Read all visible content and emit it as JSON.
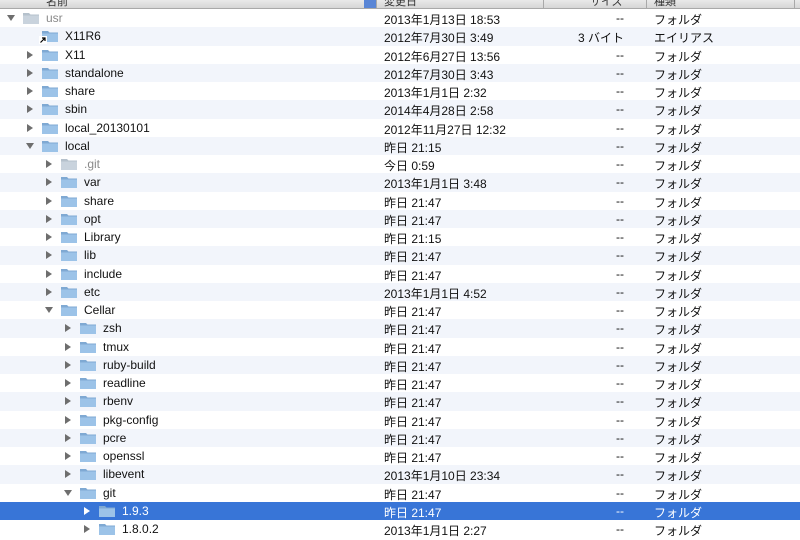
{
  "columns": {
    "name": "名前",
    "date": "変更日",
    "size": "サイズ",
    "kind": "種類"
  },
  "colors": {
    "selection": "#3875d7",
    "folder_body": "#9cc3e8",
    "folder_tab": "#7fa9d3",
    "alternate_row": "#f2f5fb"
  },
  "rows": [
    {
      "name": "usr",
      "date": "2013年1月13日 18:53",
      "size": "--",
      "kind": "フォルダ",
      "depth": 0,
      "expanded": true,
      "has_children": true,
      "dim": true
    },
    {
      "name": "X11R6",
      "date": "2012年7月30日 3:49",
      "size": "3 バイト",
      "kind": "エイリアス",
      "depth": 1,
      "expanded": false,
      "has_children": false,
      "alias": true
    },
    {
      "name": "X11",
      "date": "2012年6月27日 13:56",
      "size": "--",
      "kind": "フォルダ",
      "depth": 1,
      "expanded": false,
      "has_children": true
    },
    {
      "name": "standalone",
      "date": "2012年7月30日 3:43",
      "size": "--",
      "kind": "フォルダ",
      "depth": 1,
      "expanded": false,
      "has_children": true
    },
    {
      "name": "share",
      "date": "2013年1月1日 2:32",
      "size": "--",
      "kind": "フォルダ",
      "depth": 1,
      "expanded": false,
      "has_children": true
    },
    {
      "name": "sbin",
      "date": "2014年4月28日 2:58",
      "size": "--",
      "kind": "フォルダ",
      "depth": 1,
      "expanded": false,
      "has_children": true
    },
    {
      "name": "local_20130101",
      "date": "2012年11月27日 12:32",
      "size": "--",
      "kind": "フォルダ",
      "depth": 1,
      "expanded": false,
      "has_children": true
    },
    {
      "name": "local",
      "date": "昨日 21:15",
      "size": "--",
      "kind": "フォルダ",
      "depth": 1,
      "expanded": true,
      "has_children": true
    },
    {
      "name": ".git",
      "date": "今日 0:59",
      "size": "--",
      "kind": "フォルダ",
      "depth": 2,
      "expanded": false,
      "has_children": true,
      "dim": true
    },
    {
      "name": "var",
      "date": "2013年1月1日 3:48",
      "size": "--",
      "kind": "フォルダ",
      "depth": 2,
      "expanded": false,
      "has_children": true
    },
    {
      "name": "share",
      "date": "昨日 21:47",
      "size": "--",
      "kind": "フォルダ",
      "depth": 2,
      "expanded": false,
      "has_children": true
    },
    {
      "name": "opt",
      "date": "昨日 21:47",
      "size": "--",
      "kind": "フォルダ",
      "depth": 2,
      "expanded": false,
      "has_children": true
    },
    {
      "name": "Library",
      "date": "昨日 21:15",
      "size": "--",
      "kind": "フォルダ",
      "depth": 2,
      "expanded": false,
      "has_children": true
    },
    {
      "name": "lib",
      "date": "昨日 21:47",
      "size": "--",
      "kind": "フォルダ",
      "depth": 2,
      "expanded": false,
      "has_children": true
    },
    {
      "name": "include",
      "date": "昨日 21:47",
      "size": "--",
      "kind": "フォルダ",
      "depth": 2,
      "expanded": false,
      "has_children": true
    },
    {
      "name": "etc",
      "date": "2013年1月1日 4:52",
      "size": "--",
      "kind": "フォルダ",
      "depth": 2,
      "expanded": false,
      "has_children": true
    },
    {
      "name": "Cellar",
      "date": "昨日 21:47",
      "size": "--",
      "kind": "フォルダ",
      "depth": 2,
      "expanded": true,
      "has_children": true
    },
    {
      "name": "zsh",
      "date": "昨日 21:47",
      "size": "--",
      "kind": "フォルダ",
      "depth": 3,
      "expanded": false,
      "has_children": true
    },
    {
      "name": "tmux",
      "date": "昨日 21:47",
      "size": "--",
      "kind": "フォルダ",
      "depth": 3,
      "expanded": false,
      "has_children": true
    },
    {
      "name": "ruby-build",
      "date": "昨日 21:47",
      "size": "--",
      "kind": "フォルダ",
      "depth": 3,
      "expanded": false,
      "has_children": true
    },
    {
      "name": "readline",
      "date": "昨日 21:47",
      "size": "--",
      "kind": "フォルダ",
      "depth": 3,
      "expanded": false,
      "has_children": true
    },
    {
      "name": "rbenv",
      "date": "昨日 21:47",
      "size": "--",
      "kind": "フォルダ",
      "depth": 3,
      "expanded": false,
      "has_children": true
    },
    {
      "name": "pkg-config",
      "date": "昨日 21:47",
      "size": "--",
      "kind": "フォルダ",
      "depth": 3,
      "expanded": false,
      "has_children": true
    },
    {
      "name": "pcre",
      "date": "昨日 21:47",
      "size": "--",
      "kind": "フォルダ",
      "depth": 3,
      "expanded": false,
      "has_children": true
    },
    {
      "name": "openssl",
      "date": "昨日 21:47",
      "size": "--",
      "kind": "フォルダ",
      "depth": 3,
      "expanded": false,
      "has_children": true
    },
    {
      "name": "libevent",
      "date": "2013年1月10日 23:34",
      "size": "--",
      "kind": "フォルダ",
      "depth": 3,
      "expanded": false,
      "has_children": true
    },
    {
      "name": "git",
      "date": "昨日 21:47",
      "size": "--",
      "kind": "フォルダ",
      "depth": 3,
      "expanded": true,
      "has_children": true
    },
    {
      "name": "1.9.3",
      "date": "昨日 21:47",
      "size": "--",
      "kind": "フォルダ",
      "depth": 4,
      "expanded": false,
      "has_children": true,
      "selected": true
    },
    {
      "name": "1.8.0.2",
      "date": "2013年1月1日 2:27",
      "size": "--",
      "kind": "フォルダ",
      "depth": 4,
      "expanded": false,
      "has_children": true
    }
  ]
}
